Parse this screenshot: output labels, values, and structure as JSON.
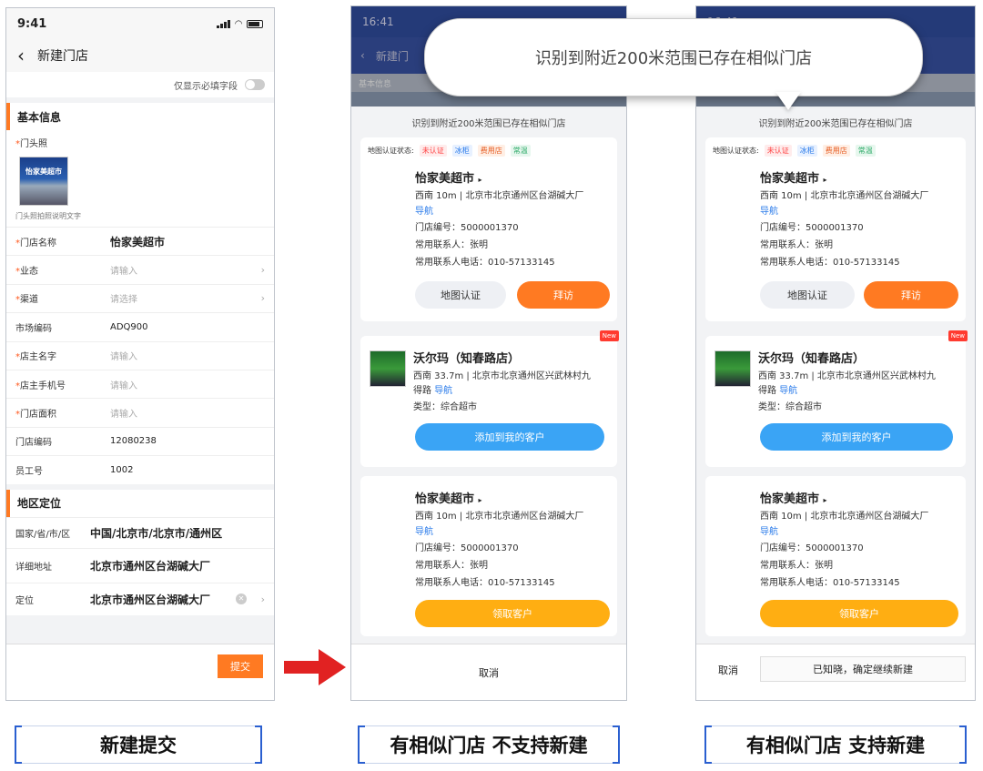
{
  "phone1": {
    "status_time": "9:41",
    "title": "新建门店",
    "toggle_label": "仅显示必填字段",
    "section_basic": "基本信息",
    "photo_label": "门头照",
    "photo_sign": "怡家美超市",
    "photo_caption": "门头照拍照说明文字",
    "fields": [
      {
        "label": "门店名称",
        "value": "怡家美超市",
        "required": true
      },
      {
        "label": "业态",
        "placeholder": "请输入",
        "required": true
      },
      {
        "label": "渠道",
        "placeholder": "请选择",
        "required": true
      },
      {
        "label": "市场编码",
        "value": "ADQ900",
        "required": false
      },
      {
        "label": "店主名字",
        "placeholder": "请输入",
        "required": true
      },
      {
        "label": "店主手机号",
        "placeholder": "请输入",
        "required": true
      },
      {
        "label": "门店面积",
        "placeholder": "请输入",
        "required": true
      },
      {
        "label": "门店编码",
        "value": "12080238",
        "required": false
      },
      {
        "label": "员工号",
        "value": "1002",
        "required": false
      }
    ],
    "section_location": "地区定位",
    "region_label": "国家/省/市/区",
    "region_value": "中国/北京市/北京市/通州区",
    "address_label": "详细地址",
    "address_value": "北京市通州区台湖碱大厂",
    "locate_label": "定位",
    "locate_value": "北京市通州区台湖碱大厂",
    "submit_label": "提交"
  },
  "dim": {
    "time": "16:41",
    "title": "新建门",
    "sub": "基本信息"
  },
  "bubble_text": "识别到附近200米范围已存在相似门店",
  "sheet": {
    "title": "识别到附近200米范围已存在相似门店",
    "auth_label": "地图认证状态:",
    "tags": [
      "未认证",
      "冰柜",
      "费用店",
      "常温"
    ],
    "card1": {
      "name": "怡家美超市",
      "distance": "西南 10m | 北京市北京通州区台湖碱大厂",
      "nav": "导航",
      "code": "门店编号：5000001370",
      "contact": "常用联系人：张明",
      "phone": "常用联系人电话：010-57133145",
      "btn_map": "地图认证",
      "btn_visit": "拜访"
    },
    "card2": {
      "badge": "New",
      "name": "沃尔玛（知春路店）",
      "distance": "西南 33.7m | 北京市北京通州区兴武林村九",
      "distance2": "得路",
      "nav": "导航",
      "type": "类型：综合超市",
      "btn_add": "添加到我的客户"
    },
    "card3": {
      "name": "怡家美超市",
      "distance": "西南 10m | 北京市北京通州区台湖碱大厂",
      "nav": "导航",
      "code": "门店编号：5000001370",
      "contact": "常用联系人：张明",
      "phone": "常用联系人电话：010-57133145",
      "btn_claim": "领取客户"
    },
    "cancel": "取消",
    "confirm": "已知晓，确定继续新建"
  },
  "captions": [
    "新建提交",
    "有相似门店 不支持新建",
    "有相似门店 支持新建"
  ]
}
